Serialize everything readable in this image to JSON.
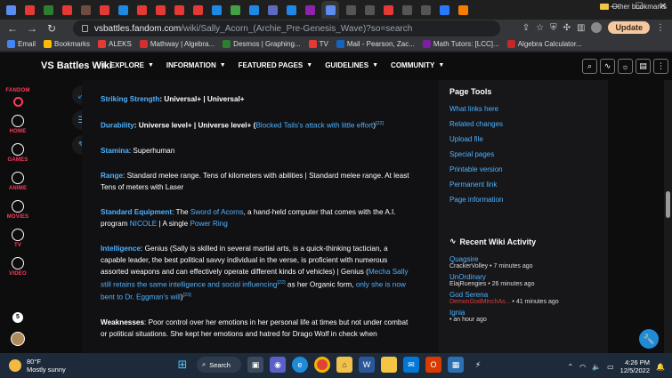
{
  "browser": {
    "url_host": "vsbattles.fandom.com",
    "url_path": "/wiki/Sally_Acorn_(Archie_Pre-Genesis_Wave)?so=search",
    "update_label": "Update",
    "tab_colors": [
      "#5a8dee",
      "#e53935",
      "#2e7d32",
      "#e53935",
      "#6d4c41",
      "#e53935",
      "#1e88e5",
      "#e53935",
      "#e53935",
      "#e53935",
      "#e53935",
      "#1e88e5",
      "#43a047",
      "#1e88e5",
      "#5c6bc0",
      "#1e88e5",
      "#8e24aa",
      "#5a8dee",
      "#555555",
      "#555555",
      "#e53935",
      "#555555",
      "#555555",
      "#2979ff",
      "#f57c00"
    ]
  },
  "bookmarks": [
    {
      "label": "Email",
      "color": "#4285f4"
    },
    {
      "label": "Bookmarks",
      "color": "#fbbc04"
    },
    {
      "label": "ALEKS",
      "color": "#e53935"
    },
    {
      "label": "Mathway | Algebra...",
      "color": "#d32f2f"
    },
    {
      "label": "Desmos | Graphing...",
      "color": "#2e7d32"
    },
    {
      "label": "TV",
      "color": "#e53935"
    },
    {
      "label": "Mail - Pearson, Zac...",
      "color": "#1565c0"
    },
    {
      "label": "Math Tutors: [LCC]...",
      "color": "#7b1fa2"
    },
    {
      "label": "Algebra Calculator...",
      "color": "#c62828"
    }
  ],
  "bookmarks_other": "Other bookmarks",
  "site": {
    "title": "VS Battles Wiki",
    "nav": [
      "EXPLORE",
      "INFORMATION",
      "FEATURED PAGES",
      "GUIDELINES",
      "COMMUNITY"
    ]
  },
  "rail": {
    "brand": "FANDOM",
    "items": [
      "HOME",
      "GAMES",
      "ANIME",
      "MOVIES",
      "TV",
      "VIDEO"
    ],
    "notif_count": "5"
  },
  "article": {
    "striking_label": "Striking Strength",
    "striking_value": ": Universal+ | Universal+",
    "durability_label": "Durability",
    "durability_value": ": Universe level+ | Universe level+ (",
    "durability_link": "Blocked Tails's attack with little effort",
    "durability_close": ")",
    "durability_ref": "[22]",
    "stamina_label": "Stamina",
    "stamina_value": ": Superhuman",
    "range_label": "Range",
    "range_value": ": Standard melee range. Tens of kilometers with abilities | Standard melee range. At least Tens of meters with Laser",
    "equipment_label": "Standard Equipment",
    "equipment_pre": ": The ",
    "equipment_link1": "Sword of Acorns",
    "equipment_mid": ", a hand-held computer that comes with the A.I. program ",
    "equipment_link2": "NICOLE",
    "equipment_mid2": " | A single ",
    "equipment_link3": "Power Ring",
    "intel_label": "Intelligence",
    "intel_value": ": Genius (Sally is skilled in several martial arts, is a quick-thinking tactician, a capable leader, the best political savvy individual in the verse, is proficient with numerous assorted weapons and can effectively operate different kinds of vehicles) | Genius (",
    "intel_link1": "Mecha Sally still retains the same intelligence and social influencing",
    "intel_ref1": "[22]",
    "intel_mid": " as her Organic form, ",
    "intel_link2": "only she is now bent to Dr. Eggman's will",
    "intel_end": ")",
    "intel_ref2": "[23]",
    "weak_label": "Weaknesses",
    "weak_value": ": Poor control over her emotions in her personal life at times but not under combat or political situations. She kept her emotions and hatred for Drago Wolf in check when"
  },
  "page_tools": {
    "title": "Page Tools",
    "links": [
      "What links here",
      "Related changes",
      "Upload file",
      "Special pages",
      "Printable version",
      "Permanent link",
      "Page information"
    ]
  },
  "wiki_activity": {
    "title": "Recent Wiki Activity",
    "items": [
      {
        "page": "Quagsire",
        "user": "CrackerVolley",
        "time": "7 minutes ago"
      },
      {
        "page": "UnOrdinary",
        "user": "ElajRuengies",
        "time": "26 minutes ago"
      },
      {
        "page": "God Serena",
        "user": "DemonGodMinchAs...",
        "time": "41 minutes ago"
      },
      {
        "page": "Ignia",
        "user": "",
        "time": "an hour ago"
      }
    ]
  },
  "taskbar": {
    "temp": "80°F",
    "condition": "Mostly sunny",
    "search_label": "Search",
    "time": "4:26 PM",
    "date": "12/5/2022"
  }
}
